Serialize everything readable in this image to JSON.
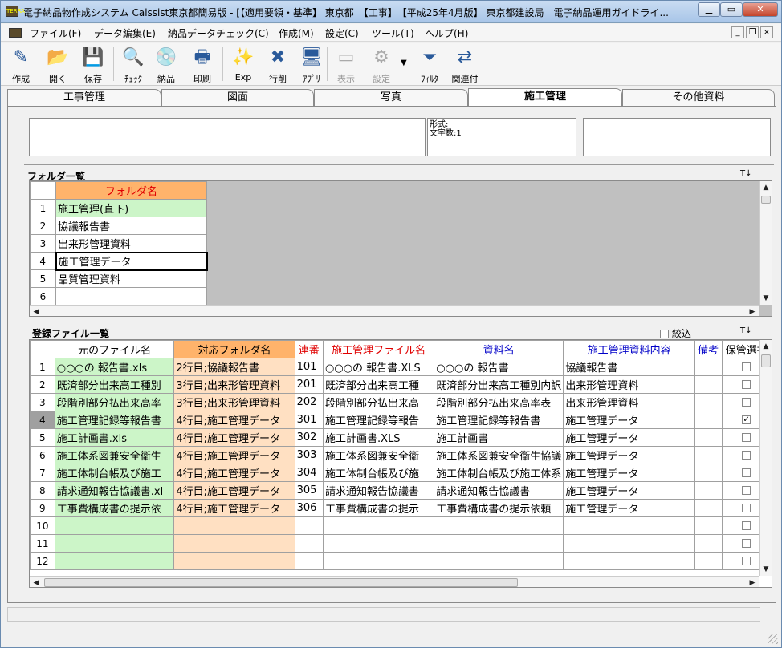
{
  "window": {
    "title": "電子納品物作成システム Calssist東京都簡易版 - [【適用要領・基準】 東京都　【工事】　【平成25年4月版】 東京都建設局　電子納品運用ガイドライ...",
    "app_icon": "TERRA"
  },
  "menu": [
    "ファイル(F)",
    "データ編集(E)",
    "納品データチェック(C)",
    "作成(M)",
    "設定(C)",
    "ツール(T)",
    "ヘルプ(H)"
  ],
  "toolbar": {
    "items": [
      {
        "label": "作成",
        "icon": "pen-doc-icon",
        "glyph": "✎",
        "enabled": true
      },
      {
        "label": "開く",
        "icon": "open-folder-icon",
        "glyph": "📂",
        "enabled": true
      },
      {
        "label": "保存",
        "icon": "floppy-icon",
        "glyph": "💾",
        "enabled": true
      },
      {
        "label": "ﾁｪｯｸ",
        "icon": "magnifier-icon",
        "glyph": "🔍",
        "enabled": true
      },
      {
        "label": "納品",
        "icon": "cd-icon",
        "glyph": "💿",
        "enabled": true
      },
      {
        "label": "印刷",
        "icon": "printer-icon",
        "glyph": "🖶",
        "enabled": true
      },
      {
        "label": "Exp",
        "icon": "star-export-icon",
        "glyph": "✨",
        "enabled": true
      },
      {
        "label": "行削",
        "icon": "row-delete-icon",
        "glyph": "✖",
        "enabled": true
      },
      {
        "label": "ｱﾌﾟﾘ",
        "icon": "monitor-icon",
        "glyph": "🖥",
        "enabled": true
      },
      {
        "label": "表示",
        "icon": "view-icon",
        "glyph": "▭",
        "enabled": false
      },
      {
        "label": "設定",
        "icon": "settings-icon",
        "glyph": "⚙",
        "enabled": false
      },
      {
        "label": "ﾌｨﾙﾀ",
        "icon": "filter-icon",
        "glyph": "⏷",
        "enabled": true
      },
      {
        "label": "関連付",
        "icon": "link-icon",
        "glyph": "⇄",
        "enabled": true
      }
    ]
  },
  "tabs": [
    {
      "label": "工事管理",
      "active": false
    },
    {
      "label": "図面",
      "active": false
    },
    {
      "label": "写真",
      "active": false
    },
    {
      "label": "施工管理",
      "active": true
    },
    {
      "label": "その他資料",
      "active": false
    }
  ],
  "info": {
    "format_label": "形式:",
    "charcount_label": "文字数:1"
  },
  "folders": {
    "title": "フォルダ一覧",
    "header": "フォルダ名",
    "rows": [
      "施工管理(直下)",
      "協議報告書",
      "出来形管理資料",
      "施工管理データ",
      "品質管理資料",
      ""
    ],
    "selected": 3
  },
  "files": {
    "title": "登録ファイル一覧",
    "filter_label": "絞込",
    "columns": [
      "元のファイル名",
      "対応フォルダ名",
      "連番",
      "施工管理ファイル名",
      "資料名",
      "施工管理資料内容",
      "備考",
      "保管選択"
    ],
    "selected_row": 3,
    "rows": [
      [
        "○○○の 報告書.xls",
        "2行目;協議報告書",
        "101",
        "○○○の 報告書.XLS",
        "○○○の 報告書",
        "協議報告書",
        "",
        false
      ],
      [
        "既済部分出来高工種別",
        "3行目;出来形管理資料",
        "201",
        "既済部分出来高工種",
        "既済部分出来高工種別内訳",
        "出来形管理資料",
        "",
        false
      ],
      [
        "段階別部分払出来高率",
        "3行目;出来形管理資料",
        "202",
        "段階別部分払出来高",
        "段階別部分払出来高率表",
        "出来形管理資料",
        "",
        false
      ],
      [
        "施工管理記録等報告書",
        "4行目;施工管理データ",
        "301",
        "施工管理記録等報告",
        "施工管理記録等報告書",
        "施工管理データ",
        "",
        true
      ],
      [
        "施工計画書.xls",
        "4行目;施工管理データ",
        "302",
        "施工計画書.XLS",
        "施工計画書",
        "施工管理データ",
        "",
        false
      ],
      [
        "施工体系図兼安全衛生",
        "4行目;施工管理データ",
        "303",
        "施工体系図兼安全衛",
        "施工体系図兼安全衛生協議",
        "施工管理データ",
        "",
        false
      ],
      [
        "施工体制台帳及び施工",
        "4行目;施工管理データ",
        "304",
        "施工体制台帳及び施",
        "施工体制台帳及び施工体系",
        "施工管理データ",
        "",
        false
      ],
      [
        "請求通知報告協議書.xl",
        "4行目;施工管理データ",
        "305",
        "請求通知報告協議書",
        "請求通知報告協議書",
        "施工管理データ",
        "",
        false
      ],
      [
        "工事費構成書の提示依",
        "4行目;施工管理データ",
        "306",
        "工事費構成書の提示",
        "工事費構成書の提示依頼",
        "施工管理データ",
        "",
        false
      ],
      [
        "",
        "",
        "",
        "",
        "",
        "",
        "",
        false
      ],
      [
        "",
        "",
        "",
        "",
        "",
        "",
        "",
        false
      ],
      [
        "",
        "",
        "",
        "",
        "",
        "",
        "",
        false
      ]
    ]
  },
  "colors": {
    "folder_header": "#ffb36b",
    "folder_cell": "#ccf5c8",
    "orig_col": "#ccf5c8",
    "map_header": "#ffb36b",
    "map_col": "#ffe0c2",
    "red_header": "#e00000",
    "blue_header": "#0000c8"
  }
}
